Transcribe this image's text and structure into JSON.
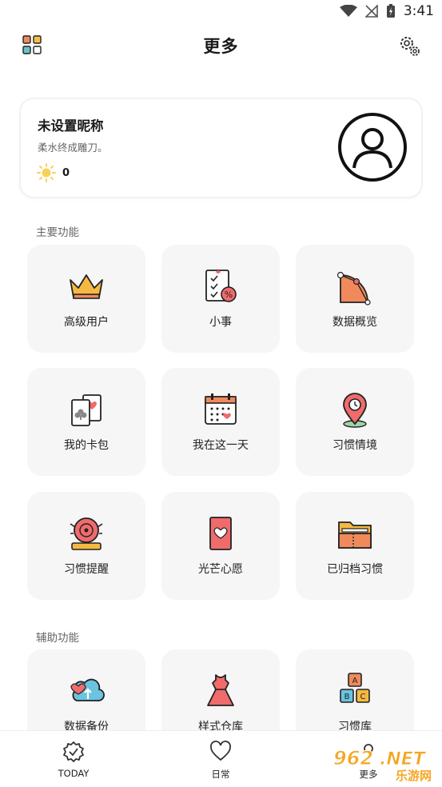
{
  "status_bar": {
    "time": "3:41"
  },
  "header": {
    "title": "更多"
  },
  "profile": {
    "nickname": "未设置昵称",
    "motto": "柔水终成雕刀。",
    "points": "0"
  },
  "sections": {
    "main": "主要功能",
    "aux": "辅助功能"
  },
  "main_features": [
    {
      "label": "高级用户",
      "icon": "crown-icon"
    },
    {
      "label": "小事",
      "icon": "checklist-icon"
    },
    {
      "label": "数据概览",
      "icon": "chart-icon"
    },
    {
      "label": "我的卡包",
      "icon": "cards-icon"
    },
    {
      "label": "我在这一天",
      "icon": "calendar-icon"
    },
    {
      "label": "习惯情境",
      "icon": "location-pin-icon"
    },
    {
      "label": "习惯提醒",
      "icon": "alarm-bell-icon"
    },
    {
      "label": "光芒心愿",
      "icon": "heart-card-icon"
    },
    {
      "label": "已归档习惯",
      "icon": "folder-icon"
    }
  ],
  "aux_features": [
    {
      "label": "数据备份",
      "icon": "cloud-backup-icon"
    },
    {
      "label": "样式仓库",
      "icon": "dress-icon"
    },
    {
      "label": "习惯库",
      "icon": "abc-blocks-icon"
    }
  ],
  "bottom_nav": [
    {
      "label": "TODAY",
      "icon": "badge-check-icon"
    },
    {
      "label": "日常",
      "icon": "heart-outline-icon"
    },
    {
      "label": "更多",
      "icon": "more-icon"
    }
  ],
  "watermark": {
    "text": "962.NET",
    "sub": "乐游网"
  },
  "colors": {
    "accent_orange": "#f08a5d",
    "tile_bg": "#f6f6f6",
    "text": "#222222"
  }
}
